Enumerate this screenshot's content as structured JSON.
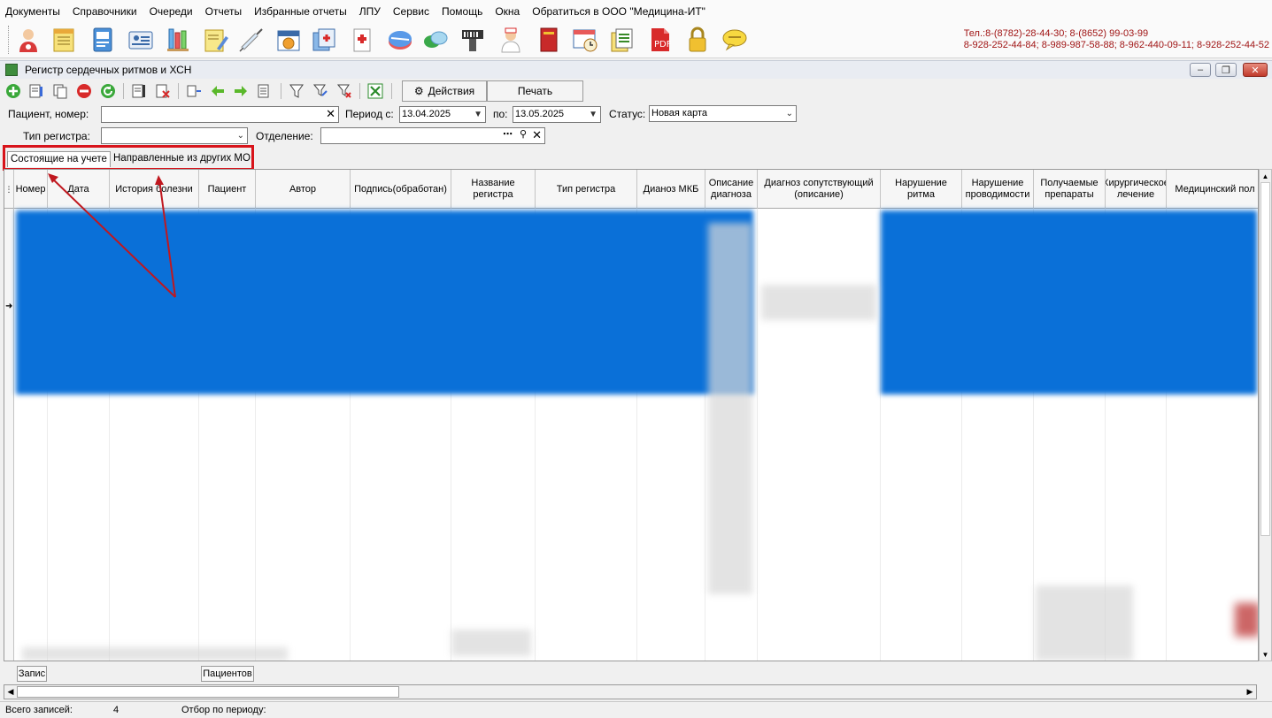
{
  "menu": [
    "Документы",
    "Справочники",
    "Очереди",
    "Отчеты",
    "Избранные отчеты",
    "ЛПУ",
    "Сервис",
    "Помощь",
    "Окна",
    "Обратиться в ООО \"Медицина-ИТ\""
  ],
  "contacts": {
    "line1": "Тел.:8-(8782)-28-44-30; 8-(8652) 99-03-99",
    "line2": "8-928-252-44-84; 8-989-987-58-88; 8-962-440-09-11; 8-928-252-44-52"
  },
  "window": {
    "title": "Регистр сердечных ритмов и ХСН",
    "minimize": "‒",
    "restore": "❐",
    "close": "✕"
  },
  "toolbar": {
    "actions_label": "Действия",
    "print_label": "Печать"
  },
  "filters": {
    "patient_label": "Пациент, номер:",
    "patient_value": "",
    "period_label": "Период с:",
    "period_from": "13.04.2025",
    "period_to_label": "по:",
    "period_to": "13.05.2025",
    "status_label": "Статус:",
    "status_value": "Новая карта",
    "register_type_label": "Тип регистра:",
    "register_type_value": "",
    "department_label": "Отделение:",
    "department_value": ""
  },
  "tabs": [
    {
      "label": "Состоящие на учете",
      "active": true
    },
    {
      "label": "Направленные из других МО",
      "active": false
    }
  ],
  "grid": {
    "columns": [
      "Номер",
      "Дата",
      "История болезни",
      "Пациент",
      "Автор",
      "Подпись(обработан)",
      "Название регистра",
      "Тип регистра",
      "Дианоз МКБ",
      "Описание диагноза",
      "Диагноз сопутствующий (описание)",
      "Нарушение ритма",
      "Нарушение проводимости",
      "Получаемые препараты",
      "Хирургическое лечение",
      "Медицинский пол"
    ]
  },
  "footer": {
    "records_button": "Запис",
    "patients_button": "Пациентов"
  },
  "status": {
    "total_label": "Всего записей:",
    "total_value": "4",
    "period_filter_label": "Отбор по периоду:"
  },
  "colors": {
    "selection": "#0a70d8",
    "highlight_border": "#d8141b",
    "contacts_text": "#a01515"
  }
}
